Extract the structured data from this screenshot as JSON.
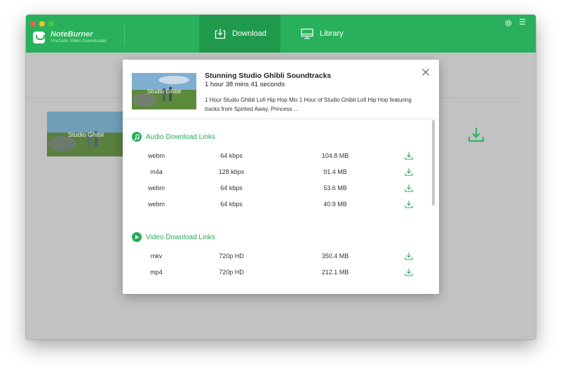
{
  "app": {
    "name": "NoteBurner",
    "subtitle": "YouTube Video Downloader",
    "accent": "#28b15a"
  },
  "tabs": [
    {
      "label": "Download",
      "icon": "download-tray-icon",
      "active": true
    },
    {
      "label": "Library",
      "icon": "monitor-icon",
      "active": false
    }
  ],
  "background_item": {
    "thumb_text": "Studio Ghibli"
  },
  "dialog": {
    "video": {
      "title": "Stunning Studio Ghibli Soundtracks",
      "duration": "1 hour 38 mins 41 seconds",
      "description": "1 Hour Studio Ghibli Lofi Hip Hop Mix 1 Hour of Studio Ghibli Lofi Hip Hop featuring tracks from Spirited Away, Princess ...",
      "thumb_text": "Studio Ghibli"
    },
    "audio_section": {
      "title": "Audio Download Links",
      "rows": [
        {
          "format": "webm",
          "quality": "64 kbps",
          "size": "104.8 MB"
        },
        {
          "format": "m4a",
          "quality": "128 kbps",
          "size": "91.4 MB"
        },
        {
          "format": "webm",
          "quality": "64 kbps",
          "size": "53.6 MB"
        },
        {
          "format": "webm",
          "quality": "64 kbps",
          "size": "40.9 MB"
        }
      ]
    },
    "video_section": {
      "title": "Video Download Links",
      "rows": [
        {
          "format": "mkv",
          "quality": "720p HD",
          "size": "350.4 MB"
        },
        {
          "format": "mp4",
          "quality": "720p HD",
          "size": "212.1 MB"
        }
      ]
    }
  }
}
